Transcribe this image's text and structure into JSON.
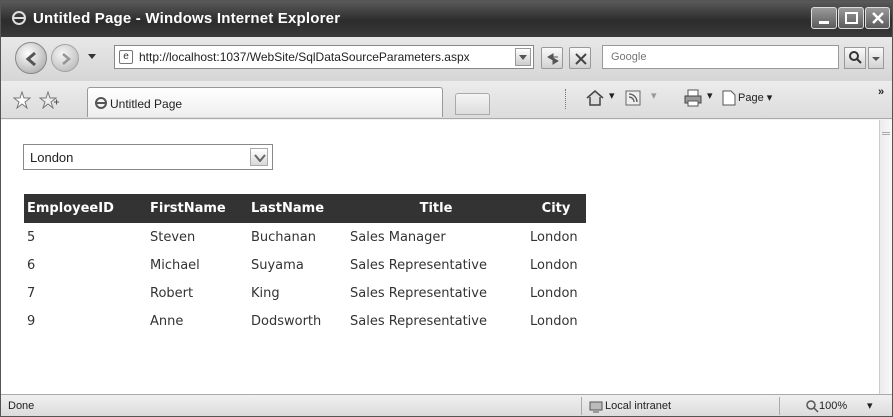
{
  "window": {
    "title": "Untitled Page - Windows Internet Explorer"
  },
  "address_bar": {
    "url": "http://localhost:1037/WebSite/SqlDataSourceParameters.aspx",
    "search_placeholder": "Google"
  },
  "tabs": [
    {
      "label": "Untitled Page"
    }
  ],
  "command_bar": {
    "page_label": "Page"
  },
  "content": {
    "city_dropdown": {
      "selected": "London"
    },
    "grid": {
      "headers": [
        "EmployeeID",
        "FirstName",
        "LastName",
        "Title",
        "City"
      ],
      "rows": [
        [
          "5",
          "Steven",
          "Buchanan",
          "Sales Manager",
          "London"
        ],
        [
          "6",
          "Michael",
          "Suyama",
          "Sales Representative",
          "London"
        ],
        [
          "7",
          "Robert",
          "King",
          "Sales Representative",
          "London"
        ],
        [
          "9",
          "Anne",
          "Dodsworth",
          "Sales Representative",
          "London"
        ]
      ]
    }
  },
  "status_bar": {
    "status": "Done",
    "zone": "Local intranet",
    "zoom": "100%"
  },
  "icons": [
    "ie-logo-icon",
    "minimize-icon",
    "maximize-icon",
    "close-icon",
    "back-arrow-icon",
    "forward-arrow-icon",
    "refresh-icon",
    "stop-icon",
    "search-icon",
    "favorites-star-icon",
    "add-favorite-icon",
    "home-icon",
    "feeds-icon",
    "print-icon",
    "page-icon",
    "chevron-down-icon",
    "intranet-icon",
    "zoom-icon"
  ]
}
